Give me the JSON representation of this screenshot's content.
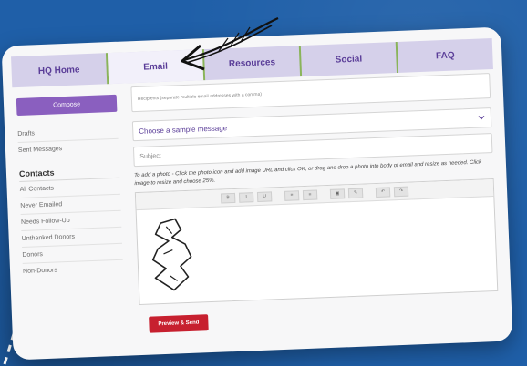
{
  "tabs": [
    {
      "label": "HQ Home"
    },
    {
      "label": "Email"
    },
    {
      "label": "Resources"
    },
    {
      "label": "Social"
    },
    {
      "label": "FAQ"
    }
  ],
  "sidebar": {
    "compose_label": "Compose",
    "items_top": [
      "Drafts",
      "Sent Messages"
    ],
    "contacts_heading": "Contacts",
    "contacts": [
      "All Contacts",
      "Never Emailed",
      "Needs Follow-Up",
      "Unthanked Donors",
      "Donors",
      "Non-Donors"
    ]
  },
  "form": {
    "recipients_placeholder": "Recipients (separate multiple email addresses with a comma)",
    "template_select_value": "Choose a sample message",
    "subject_placeholder": "Subject",
    "hint": "To add a photo - Click the photo icon and add image URL and click OK, or drag and drop a photo into body of email and resize as needed. Click image to resize and choose 25%.",
    "preview_button": "Preview & Send"
  },
  "toolbar": {
    "bold": "B",
    "italic": "I",
    "underline": "U",
    "list_ul": "≡",
    "list_ol": "≡",
    "image": "▣",
    "link": "✎",
    "undo": "↶",
    "redo": "↷"
  }
}
